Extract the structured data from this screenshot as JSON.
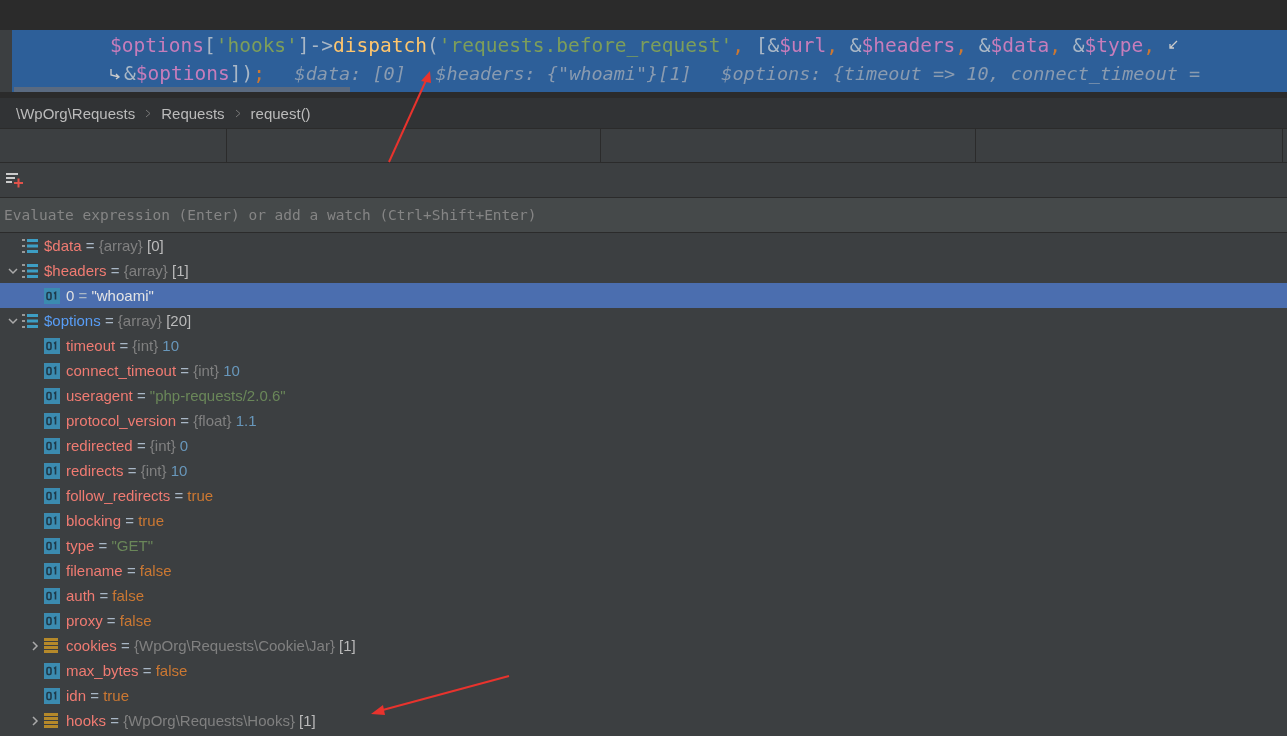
{
  "editor": {
    "lines": [
      {
        "tokens": [
          {
            "kind": "var",
            "text": "$options"
          },
          {
            "kind": "plain",
            "text": "["
          },
          {
            "kind": "string",
            "text": "'hooks'"
          },
          {
            "kind": "plain",
            "text": "]->"
          },
          {
            "kind": "func",
            "text": "dispatch"
          },
          {
            "kind": "plain",
            "text": "("
          },
          {
            "kind": "string",
            "text": "'requests.before_request'"
          },
          {
            "kind": "punct",
            "text": ", "
          },
          {
            "kind": "plain",
            "text": "[&"
          },
          {
            "kind": "var",
            "text": "$url"
          },
          {
            "kind": "punct",
            "text": ", "
          },
          {
            "kind": "plain",
            "text": "&"
          },
          {
            "kind": "var",
            "text": "$headers"
          },
          {
            "kind": "punct",
            "text": ", "
          },
          {
            "kind": "plain",
            "text": "&"
          },
          {
            "kind": "var",
            "text": "$data"
          },
          {
            "kind": "punct",
            "text": ", "
          },
          {
            "kind": "plain",
            "text": "&"
          },
          {
            "kind": "var",
            "text": "$type"
          },
          {
            "kind": "punct",
            "text": ","
          }
        ],
        "wrap_end": true
      },
      {
        "tokens": [
          {
            "kind": "plain",
            "text": "&"
          },
          {
            "kind": "var",
            "text": "$options"
          },
          {
            "kind": "plain",
            "text": "])"
          },
          {
            "kind": "punct",
            "text": ";"
          },
          {
            "kind": "hint",
            "text": "$data: [0]"
          },
          {
            "kind": "hint",
            "text": "$headers: {\"whoami\"}[1]"
          },
          {
            "kind": "hint",
            "text": "$options: {timeout => 10, connect_timeout ="
          }
        ],
        "wrap_start": true
      }
    ]
  },
  "breadcrumb": [
    "\\WpOrg\\Requests",
    "Requests",
    "request()"
  ],
  "watch_field": {
    "placeholder": "Evaluate expression (Enter) or add a watch (Ctrl+Shift+Enter)"
  },
  "variables": [
    {
      "kind": "array",
      "name": "$data",
      "op": "=",
      "type": "{array}",
      "value": {
        "kind": "count",
        "text": "[0]"
      },
      "changed": false,
      "selected": false
    },
    {
      "kind": "array",
      "name": "$headers",
      "op": "=",
      "type": "{array}",
      "value": {
        "kind": "count",
        "text": "[1]"
      },
      "changed": false,
      "selected": false,
      "expanded": true,
      "children": [
        {
          "kind": "scalar",
          "name": "0",
          "op": "=",
          "value": {
            "kind": "plain",
            "text": "\"whoami\""
          },
          "changed": false,
          "selected": true
        }
      ]
    },
    {
      "kind": "array",
      "name": "$options",
      "op": "=",
      "type": "{array}",
      "value": {
        "kind": "count",
        "text": "[20]"
      },
      "changed": true,
      "selected": false,
      "expanded": true,
      "children": [
        {
          "kind": "scalar",
          "name": "timeout",
          "op": "=",
          "type": "{int}",
          "value": {
            "kind": "number",
            "text": "10"
          },
          "changed": false,
          "selected": false
        },
        {
          "kind": "scalar",
          "name": "connect_timeout",
          "op": "=",
          "type": "{int}",
          "value": {
            "kind": "number",
            "text": "10"
          },
          "changed": false,
          "selected": false
        },
        {
          "kind": "scalar",
          "name": "useragent",
          "op": "=",
          "value": {
            "kind": "string",
            "text": "\"php-requests/2.0.6\""
          },
          "changed": false,
          "selected": false
        },
        {
          "kind": "scalar",
          "name": "protocol_version",
          "op": "=",
          "type": "{float}",
          "value": {
            "kind": "number",
            "text": "1.1"
          },
          "changed": false,
          "selected": false
        },
        {
          "kind": "scalar",
          "name": "redirected",
          "op": "=",
          "type": "{int}",
          "value": {
            "kind": "number",
            "text": "0"
          },
          "changed": false,
          "selected": false
        },
        {
          "kind": "scalar",
          "name": "redirects",
          "op": "=",
          "type": "{int}",
          "value": {
            "kind": "number",
            "text": "10"
          },
          "changed": false,
          "selected": false
        },
        {
          "kind": "scalar",
          "name": "follow_redirects",
          "op": "=",
          "value": {
            "kind": "bool",
            "text": "true"
          },
          "changed": false,
          "selected": false
        },
        {
          "kind": "scalar",
          "name": "blocking",
          "op": "=",
          "value": {
            "kind": "bool",
            "text": "true"
          },
          "changed": false,
          "selected": false
        },
        {
          "kind": "scalar",
          "name": "type",
          "op": "=",
          "value": {
            "kind": "string",
            "text": "\"GET\""
          },
          "changed": false,
          "selected": false
        },
        {
          "kind": "scalar",
          "name": "filename",
          "op": "=",
          "value": {
            "kind": "bool",
            "text": "false"
          },
          "changed": false,
          "selected": false
        },
        {
          "kind": "scalar",
          "name": "auth",
          "op": "=",
          "value": {
            "kind": "bool",
            "text": "false"
          },
          "changed": false,
          "selected": false
        },
        {
          "kind": "scalar",
          "name": "proxy",
          "op": "=",
          "value": {
            "kind": "bool",
            "text": "false"
          },
          "changed": false,
          "selected": false
        },
        {
          "kind": "object",
          "name": "cookies",
          "op": "=",
          "type": "{WpOrg\\Requests\\Cookie\\Jar}",
          "value": {
            "kind": "count",
            "text": "[1]"
          },
          "changed": false,
          "selected": false,
          "expanded": false
        },
        {
          "kind": "scalar",
          "name": "max_bytes",
          "op": "=",
          "value": {
            "kind": "bool",
            "text": "false"
          },
          "changed": false,
          "selected": false
        },
        {
          "kind": "scalar",
          "name": "idn",
          "op": "=",
          "value": {
            "kind": "bool",
            "text": "true"
          },
          "changed": false,
          "selected": false
        },
        {
          "kind": "object",
          "name": "hooks",
          "op": "=",
          "type": "{WpOrg\\Requests\\Hooks}",
          "value": {
            "kind": "count",
            "text": "[1]"
          },
          "changed": false,
          "selected": false,
          "expanded": false
        }
      ]
    }
  ]
}
